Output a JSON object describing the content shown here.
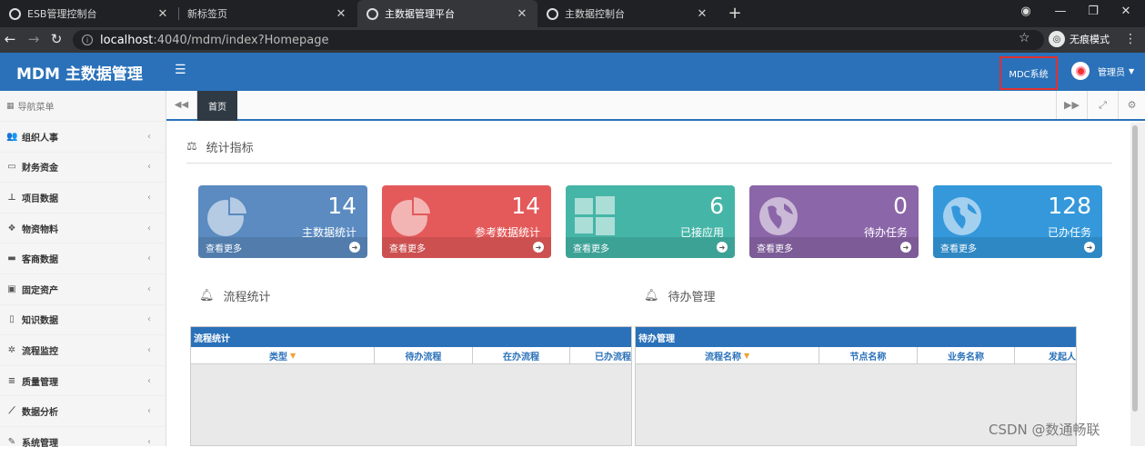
{
  "browser": {
    "tabs": [
      {
        "title": "ESB管理控制台"
      },
      {
        "title": "新标签页"
      },
      {
        "title": "主数据管理平台"
      },
      {
        "title": "主数据控制台"
      }
    ],
    "url_host": "localhost",
    "url_rest": ":4040/mdm/index?Homepage",
    "incognito_label": "无痕模式"
  },
  "app": {
    "logo": "MDM 主数据管理",
    "mdc_button": "MDC系统",
    "user_label": "管理员"
  },
  "sidebar": {
    "header": "导航菜单",
    "items": [
      {
        "label": "组织人事",
        "icon": "users-icon"
      },
      {
        "label": "财务资金",
        "icon": "credit-card-icon"
      },
      {
        "label": "项目数据",
        "icon": "sitemap-icon"
      },
      {
        "label": "物资物料",
        "icon": "cubes-icon"
      },
      {
        "label": "客商数据",
        "icon": "briefcase-icon"
      },
      {
        "label": "固定资产",
        "icon": "archive-icon"
      },
      {
        "label": "知识数据",
        "icon": "file-icon"
      },
      {
        "label": "流程监控",
        "icon": "spinner-icon"
      },
      {
        "label": "质量管理",
        "icon": "list-icon"
      },
      {
        "label": "数据分析",
        "icon": "line-chart-icon"
      },
      {
        "label": "系统管理",
        "icon": "wrench-icon"
      }
    ]
  },
  "content_tabs": {
    "home": "首页"
  },
  "stats": {
    "title": "统计指标",
    "cards": [
      {
        "value": "14",
        "label": "主数据统计",
        "more": "查看更多",
        "color": "#5b8bc0",
        "icon": "pie-chart-icon"
      },
      {
        "value": "14",
        "label": "参考数据统计",
        "more": "查看更多",
        "color": "#e45a5a",
        "icon": "pie-chart-icon"
      },
      {
        "value": "6",
        "label": "已接应用",
        "more": "查看更多",
        "color": "#45b5a7",
        "icon": "windows-icon"
      },
      {
        "value": "0",
        "label": "待办任务",
        "more": "查看更多",
        "color": "#8b66a8",
        "icon": "globe-icon"
      },
      {
        "value": "128",
        "label": "已办任务",
        "more": "查看更多",
        "color": "#3498db",
        "icon": "globe-icon"
      }
    ]
  },
  "flow": {
    "title": "流程统计",
    "panel_title": "流程统计",
    "columns": [
      "类型",
      "待办流程",
      "在办流程",
      "已办流程"
    ]
  },
  "todo": {
    "title": "待办管理",
    "panel_title": "待办管理",
    "columns": [
      "流程名称",
      "节点名称",
      "业务名称",
      "发起人"
    ]
  },
  "watermark": "CSDN @数通畅联"
}
